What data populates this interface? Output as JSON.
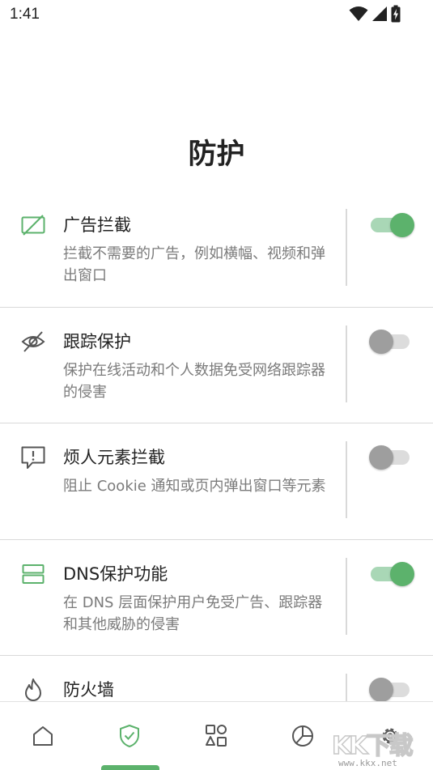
{
  "status_bar": {
    "time": "1:41",
    "icons": [
      "wifi-icon",
      "cell-signal-icon",
      "battery-charging-icon"
    ]
  },
  "page": {
    "title": "防护"
  },
  "colors": {
    "accent": "#5cb26c",
    "accent_track": "#a9d7b6",
    "toggle_off_knob": "#9e9e9e",
    "toggle_off_track": "#dcdcdc",
    "text_primary": "#222222",
    "text_secondary": "#7b7b7b",
    "divider": "#d9d9d9"
  },
  "items": [
    {
      "title": "广告拦截",
      "desc": "拦截不需要的广告，例如横幅、视频和弹出窗口",
      "enabled": true,
      "icon": "ad-block-icon"
    },
    {
      "title": "跟踪保护",
      "desc": "保护在线活动和个人数据免受网络跟踪器的侵害",
      "enabled": false,
      "icon": "eye-off-icon"
    },
    {
      "title": "烦人元素拦截",
      "desc": "阻止 Cookie 通知或页内弹出窗口等元素",
      "enabled": false,
      "icon": "annoyance-alert-icon"
    },
    {
      "title": "DNS保护功能",
      "desc": "在 DNS 层面保护用户免受广告、跟踪器和其他威胁的侵害",
      "enabled": true,
      "icon": "dns-server-icon"
    },
    {
      "title": "防火墙",
      "desc": "",
      "enabled": false,
      "icon": "flame-icon"
    }
  ],
  "bottom_nav": {
    "active": "protection",
    "tabs": [
      {
        "id": "home",
        "icon": "home-icon"
      },
      {
        "id": "protection",
        "icon": "shield-check-icon"
      },
      {
        "id": "activity",
        "icon": "apps-shapes-icon"
      },
      {
        "id": "statistics",
        "icon": "pie-chart-icon"
      },
      {
        "id": "settings",
        "icon": "gear-icon"
      }
    ]
  },
  "watermark": {
    "text": "KK下载",
    "url": "www.kkx.net"
  }
}
